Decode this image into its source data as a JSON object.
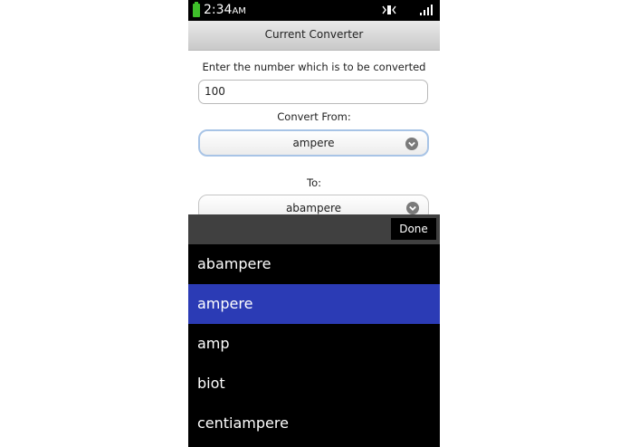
{
  "status_bar": {
    "time": "2:34",
    "ampm": "AM",
    "battery_color": "#3fbf2a"
  },
  "title": "Current Converter",
  "form": {
    "number_label": "Enter the number which is to be converted",
    "number_value": "100",
    "from_label": "Convert From:",
    "from_value": "ampere",
    "to_label": "To:",
    "to_value": "abampere"
  },
  "picker": {
    "done_label": "Done",
    "selected_index": 1,
    "selected_color": "#2b3bb5",
    "options": [
      "abampere",
      "ampere",
      "amp",
      "biot",
      "centiampere"
    ]
  }
}
